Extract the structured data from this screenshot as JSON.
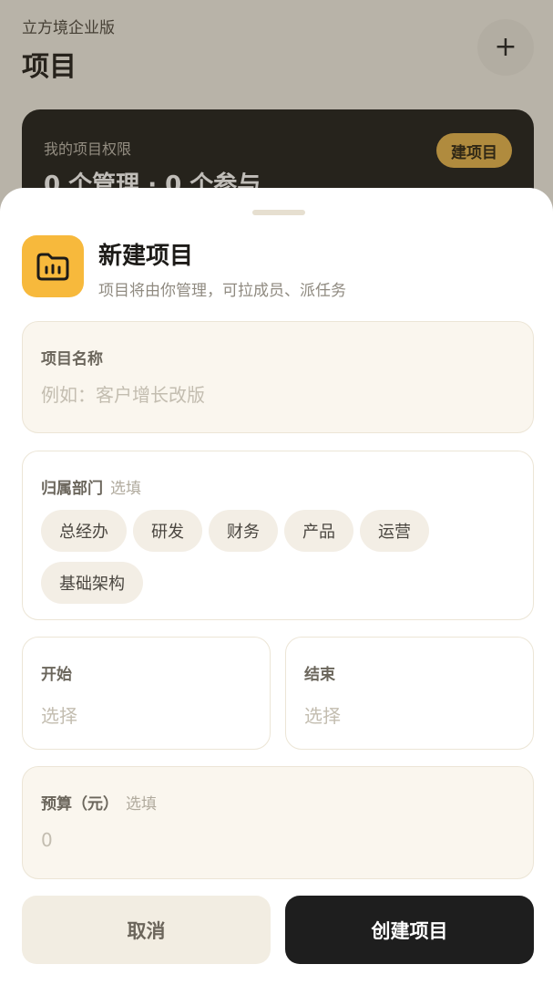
{
  "background": {
    "org_name": "立方境企业版",
    "page_title": "项目",
    "add_button": "+",
    "permissions_card": {
      "label": "我的项目权限",
      "stats": "0 个管理 · 0 个参与",
      "create_button": "建项目"
    }
  },
  "sheet": {
    "icon": "folder-icon",
    "title": "新建项目",
    "description": "项目将由你管理，可拉成员、派任务",
    "name_field": {
      "label": "项目名称",
      "placeholder": "例如：客户增长改版"
    },
    "department_field": {
      "label": "归属部门",
      "optional": "选填",
      "options": [
        "总经办",
        "研发",
        "财务",
        "产品",
        "运营",
        "基础架构"
      ]
    },
    "start_field": {
      "label": "开始",
      "value": "选择"
    },
    "end_field": {
      "label": "结束",
      "value": "选择"
    },
    "budget_field": {
      "label": "预算（元）",
      "optional": "选填",
      "placeholder": "0"
    },
    "cancel_button": "取消",
    "create_button": "创建项目"
  },
  "colors": {
    "accent": "#f7b93c",
    "primary_button": "#1e1e1e",
    "field_bg": "#faf6ee"
  }
}
